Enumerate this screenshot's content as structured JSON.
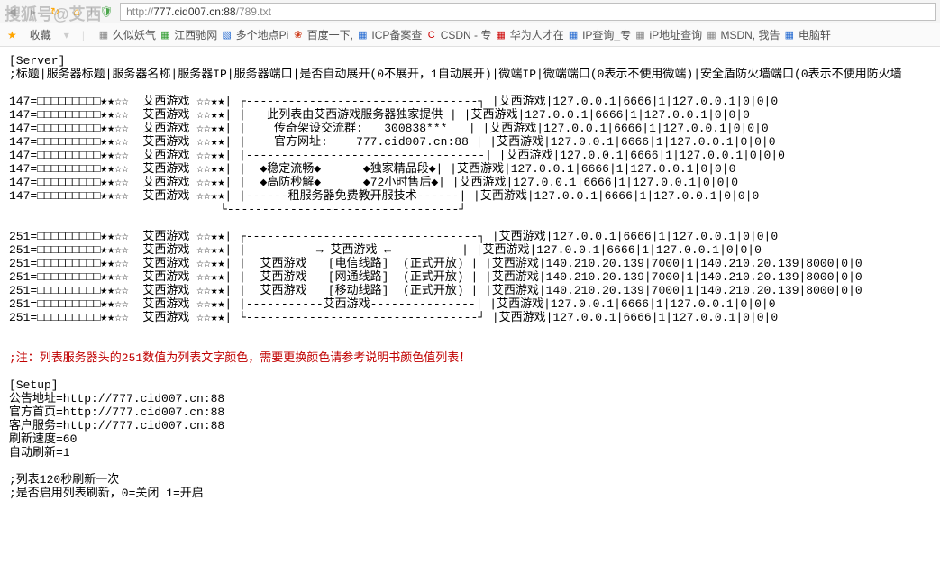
{
  "toolbar": {
    "watermark": "搜狐号@艾西",
    "url_prefix": "http://",
    "url_host": "777.cid007.cn:88",
    "url_path": "/789.txt"
  },
  "bookmarks": {
    "fav_label": "收藏",
    "items": [
      {
        "icon": "gray",
        "glyph": "▦",
        "label": "久似妖气"
      },
      {
        "icon": "green",
        "glyph": "▦",
        "label": "江西驰网"
      },
      {
        "icon": "blue",
        "glyph": "▧",
        "label": "多个地点Pi"
      },
      {
        "icon": "paw",
        "glyph": "❀",
        "label": "百度一下,"
      },
      {
        "icon": "blue",
        "glyph": "▦",
        "label": "ICP备案查"
      },
      {
        "icon": "red",
        "glyph": "C",
        "label": "CSDN - 专"
      },
      {
        "icon": "red",
        "glyph": "▦",
        "label": "华为人才在"
      },
      {
        "icon": "blue",
        "glyph": "▦",
        "label": "IP查询_专"
      },
      {
        "icon": "gray",
        "glyph": "▦",
        "label": "iP地址查询"
      },
      {
        "icon": "gray",
        "glyph": "▦",
        "label": "MSDN, 我告"
      },
      {
        "icon": "blue",
        "glyph": "▦",
        "label": "电脑轩"
      }
    ]
  },
  "body": {
    "server_header": "[Server]",
    "columns_line": ";标题|服务器标题|服务器名称|服务器IP|服务器端口|是否自动展开(0不展开，1自动展开)|微端IP|微端端口(0表示不使用微端)|安全盾防火墙端口(0表示不使用防火墙",
    "left_block1": [
      "147=□□□□□□□□□★★☆☆  艾西游戏 ☆☆★★|",
      "147=□□□□□□□□□★★☆☆  艾西游戏 ☆☆★★|",
      "147=□□□□□□□□□★★☆☆  艾西游戏 ☆☆★★|",
      "147=□□□□□□□□□★★☆☆  艾西游戏 ☆☆★★|",
      "147=□□□□□□□□□★★☆☆  艾西游戏 ☆☆★★|",
      "147=□□□□□□□□□★★☆☆  艾西游戏 ☆☆★★|",
      "147=□□□□□□□□□★★☆☆  艾西游戏 ☆☆★★|",
      "147=□□□□□□□□□★★☆☆  艾西游戏 ☆☆★★|"
    ],
    "box1": [
      "┌---------------------------------┐",
      "|   此列表由艾西游戏服务器独家提供 |",
      "|    传奇架设交流群:   300838***   |",
      "|    官方网址:    777.cid007.cn:88 |",
      "|----------------------------------|",
      "|  ◆稳定流畅◆      ◆独家精品段◆|",
      "|  ◆高防秒解◆      ◆72小时售后◆|",
      "|------租服务器免费教开服技术------|",
      "└---------------------------------┘"
    ],
    "right_block1": [
      "|艾西游戏|127.0.0.1|6666|1|127.0.0.1|0|0|0",
      "|艾西游戏|127.0.0.1|6666|1|127.0.0.1|0|0|0",
      "|艾西游戏|127.0.0.1|6666|1|127.0.0.1|0|0|0",
      "|艾西游戏|127.0.0.1|6666|1|127.0.0.1|0|0|0",
      "|艾西游戏|127.0.0.1|6666|1|127.0.0.1|0|0|0",
      "|艾西游戏|127.0.0.1|6666|1|127.0.0.1|0|0|0",
      "|艾西游戏|127.0.0.1|6666|1|127.0.0.1|0|0|0",
      "|艾西游戏|127.0.0.1|6666|1|127.0.0.1|0|0|0"
    ],
    "left_block2": [
      "251=□□□□□□□□□★★☆☆  艾西游戏 ☆☆★★|",
      "251=□□□□□□□□□★★☆☆  艾西游戏 ☆☆★★|",
      "251=□□□□□□□□□★★☆☆  艾西游戏 ☆☆★★|",
      "251=□□□□□□□□□★★☆☆  艾西游戏 ☆☆★★|",
      "251=□□□□□□□□□★★☆☆  艾西游戏 ☆☆★★|",
      "251=□□□□□□□□□★★☆☆  艾西游戏 ☆☆★★|",
      "251=□□□□□□□□□★★☆☆  艾西游戏 ☆☆★★|"
    ],
    "box2": [
      "┌---------------------------------┐",
      "|          → 艾西游戏 ←          |",
      "|  艾西游戏   [电信线路]  (正式开放) |",
      "|  艾西游戏   [网通线路]  (正式开放) |",
      "|  艾西游戏   [移动线路]  (正式开放) |",
      "|-----------艾西游戏---------------|",
      "└---------------------------------┘"
    ],
    "right_block2": [
      "|艾西游戏|127.0.0.1|6666|1|127.0.0.1|0|0|0",
      "|艾西游戏|127.0.0.1|6666|1|127.0.0.1|0|0|0",
      "|艾西游戏|140.210.20.139|7000|1|140.210.20.139|8000|0|0",
      "|艾西游戏|140.210.20.139|7000|1|140.210.20.139|8000|0|0",
      "|艾西游戏|140.210.20.139|7000|1|140.210.20.139|8000|0|0",
      "|艾西游戏|127.0.0.1|6666|1|127.0.0.1|0|0|0",
      "|艾西游戏|127.0.0.1|6666|1|127.0.0.1|0|0|0"
    ],
    "note_red": ";注：列表服务器头的251数值为列表文字颜色，需要更换颜色请参考说明书颜色值列表！",
    "setup_header": "[Setup]",
    "setup_lines": [
      "公告地址=http://777.cid007.cn:88",
      "官方首页=http://777.cid007.cn:88",
      "客户服务=http://777.cid007.cn:88",
      "刷新速度=60",
      "自动刷新=1"
    ],
    "comment1": ";列表120秒刷新一次",
    "comment2": ";是否启用列表刷新，0=关闭 1=开启"
  }
}
